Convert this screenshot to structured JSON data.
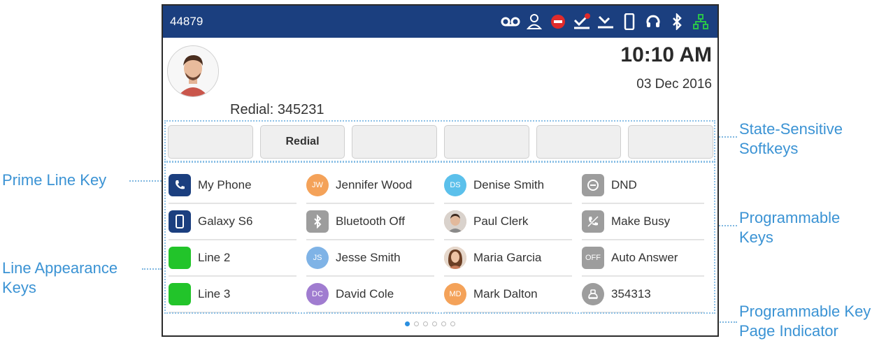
{
  "status_bar": {
    "extension": "44879",
    "icons": [
      "voicemail-icon",
      "user-icon",
      "dnd-icon",
      "missed-call-icon",
      "call-forward-icon",
      "mobile-icon",
      "headset-icon",
      "bluetooth-icon",
      "network-icon"
    ]
  },
  "home": {
    "time": "10:10 AM",
    "date": "03 Dec 2016",
    "redial_text": "Redial: 345231"
  },
  "softkeys": [
    "",
    "Redial",
    "",
    "",
    "",
    ""
  ],
  "keys": [
    [
      {
        "label": "My Phone",
        "icon": "phone-icon",
        "initials": "",
        "color": "#1b3f7f"
      },
      {
        "label": "Galaxy S6",
        "icon": "mobile-icon",
        "initials": "",
        "color": "#1b3f7f"
      },
      {
        "label": "Line 2",
        "icon": "line-indicator",
        "initials": "",
        "color": "#22c42a"
      },
      {
        "label": "Line 3",
        "icon": "line-indicator",
        "initials": "",
        "color": "#22c42a"
      }
    ],
    [
      {
        "label": "Jennifer Wood",
        "icon": "contact-avatar",
        "initials": "JW",
        "color": "#f4a259"
      },
      {
        "label": "Bluetooth Off",
        "icon": "bluetooth-icon",
        "initials": "",
        "color": "#9d9d9d"
      },
      {
        "label": "Jesse Smith",
        "icon": "contact-avatar",
        "initials": "JS",
        "color": "#7fb3e6"
      },
      {
        "label": "David Cole",
        "icon": "contact-avatar",
        "initials": "DC",
        "color": "#a07cd0"
      }
    ],
    [
      {
        "label": "Denise Smith",
        "icon": "contact-avatar",
        "initials": "DS",
        "color": "#5bc0eb"
      },
      {
        "label": "Paul Clerk",
        "icon": "contact-photo",
        "initials": "",
        "color": "#c9a184"
      },
      {
        "label": "Maria Garcia",
        "icon": "contact-photo",
        "initials": "",
        "color": "#d8b08c"
      },
      {
        "label": "Mark Dalton",
        "icon": "contact-avatar",
        "initials": "MD",
        "color": "#f4a259"
      }
    ],
    [
      {
        "label": "DND",
        "icon": "dnd-icon",
        "initials": "",
        "color": "#9d9d9d"
      },
      {
        "label": "Make Busy",
        "icon": "make-busy-icon",
        "initials": "",
        "color": "#9d9d9d"
      },
      {
        "label": "Auto Answer",
        "icon": "auto-answer-icon",
        "initials": "OFF",
        "color": "#9d9d9d"
      },
      {
        "label": "354313",
        "icon": "speed-dial-icon",
        "initials": "",
        "color": "#9d9d9d"
      }
    ]
  ],
  "pager": {
    "pages": 6,
    "current": 1
  },
  "callouts": {
    "prime_line_key": "Prime Line Key",
    "line_appearance_1": "Line Appearance",
    "line_appearance_2": "Keys",
    "softkeys_1": "State-Sensitive",
    "softkeys_2": "Softkeys",
    "programmable_1": "Programmable",
    "programmable_2": "Keys",
    "page_indicator_1": "Programmable Key",
    "page_indicator_2": "Page Indicator"
  }
}
